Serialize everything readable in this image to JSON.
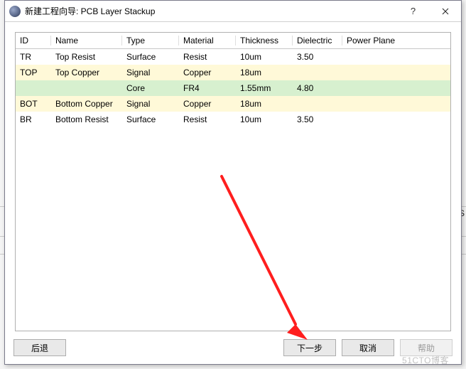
{
  "window": {
    "title": "新建工程向导: PCB Layer Stackup",
    "help_glyph": "?",
    "close_glyph": "✕"
  },
  "table": {
    "headers": {
      "id": "ID",
      "name": "Name",
      "type": "Type",
      "material": "Material",
      "thickness": "Thickness",
      "dielectric": "Dielectric",
      "powerplane": "Power Plane"
    },
    "rows": [
      {
        "id": "TR",
        "name": "Top Resist",
        "type": "Surface",
        "material": "Resist",
        "thickness": "10um",
        "dielectric": "3.50",
        "powerplane": "",
        "rowClass": ""
      },
      {
        "id": "TOP",
        "name": "Top Copper",
        "type": "Signal",
        "material": "Copper",
        "thickness": "18um",
        "dielectric": "",
        "powerplane": "",
        "rowClass": "yellow"
      },
      {
        "id": "",
        "name": "",
        "type": "Core",
        "material": "FR4",
        "thickness": "1.55mm",
        "dielectric": "4.80",
        "powerplane": "",
        "rowClass": "green"
      },
      {
        "id": "BOT",
        "name": "Bottom Copper",
        "type": "Signal",
        "material": "Copper",
        "thickness": "18um",
        "dielectric": "",
        "powerplane": "",
        "rowClass": "yellow"
      },
      {
        "id": "BR",
        "name": "Bottom Resist",
        "type": "Surface",
        "material": "Resist",
        "thickness": "10um",
        "dielectric": "3.50",
        "powerplane": "",
        "rowClass": ""
      }
    ]
  },
  "buttons": {
    "back": "后退",
    "next": "下一步",
    "cancel": "取消",
    "help": "帮助"
  },
  "backdrop": {
    "s_label": "S"
  },
  "watermark": "51CTO博客"
}
